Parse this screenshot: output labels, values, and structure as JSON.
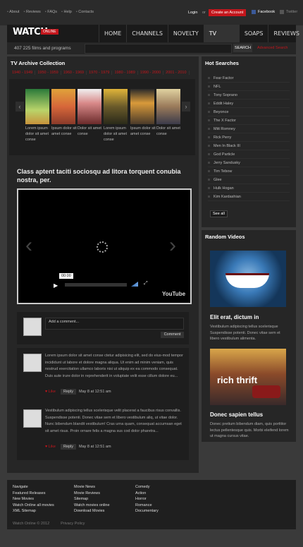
{
  "topbar": {
    "links": [
      "About",
      "Reviews",
      "FAQs",
      "Help",
      "Contacts"
    ],
    "login": "Login",
    "or": "or",
    "create_account": "Create an Account",
    "facebook": "Facebook",
    "twitter": "Twitter"
  },
  "logo": {
    "text": "WATCH",
    "badge": "ONLINE"
  },
  "nav": [
    "HOME",
    "CHANNELS",
    "NOVELTY",
    "TV ARCHIVE",
    "SOAPS",
    "REVIEWS"
  ],
  "search": {
    "count_text": "407 225 films and programs",
    "button": "SEARCH",
    "advanced": "Advanced Search"
  },
  "archive": {
    "title": "TV Archive Collection",
    "years": [
      "1940 - 1949",
      "1950 - 1959",
      "1960 - 1969",
      "1970 - 1979",
      "1980 - 1989",
      "1990 - 2000",
      "2001 - 2010"
    ],
    "items": [
      {
        "caption": "Lorem ipsum dolor sit amet conse"
      },
      {
        "caption": "Ipsum dolor sit amet conse"
      },
      {
        "caption": "Dolor sit amet conse"
      },
      {
        "caption": "Lorem ipsum dolor sit amet conse"
      },
      {
        "caption": "Ipsum dolor sit amet conse"
      },
      {
        "caption": "Dolor sit amet conse"
      }
    ]
  },
  "article": {
    "title": "Class aptent taciti sociosqu ad litora torquent conubia nostra, per."
  },
  "player": {
    "time": "00:00",
    "brand": "YouTube"
  },
  "comment_form": {
    "placeholder": "Add a comment...",
    "button": "Comment"
  },
  "comments": [
    {
      "text": "Lorem ipsum dolor sit amet conse ctetur adipisicing elit, sed do eius-mod tempor incididunt ut labore et dolore magna aliqua. Ut enim ad minim veniam, quis nostrud exercitation ullamco laboris nisi ut aliquip ex ea commodo consequat. Duis aute irure dolor in reprehenderit in voluptate velit esse cillum dolore eu...",
      "like": "Like",
      "reply": "Reply",
      "date": "May 8 at 12:51 am"
    },
    {
      "text": "Vestibulum adipiscing tellus scelerisque velit placerat a faucibus risus convallis. Suspendisse potenti. Donec vitae sem et libero vestibulum aliq, ut vitae dolor. Nunc bibendum blandit vestibulum! Cras urna quam, consequat accumsan eget sit amet risus. Proin ornare felis a magna sus cod dolor pharetra...",
      "like": "Like",
      "reply": "Reply",
      "date": "May 8 at 12:51 am"
    }
  ],
  "hot_searches": {
    "title": "Hot Searches",
    "items": [
      "Fear Factor",
      "NFL",
      "Tony Soprano",
      "Eddit Haley",
      "Beyonce",
      "The X Factor",
      "Mitt Romney",
      "Rick Perry",
      "Men In Black III",
      "God Particle",
      "Jerry Sandusky",
      "Tim Tebow",
      "Glee",
      "Hulk Hogan",
      "Kim Kardashian"
    ],
    "see_all": "See all"
  },
  "random_videos": {
    "title": "Random Videos",
    "videos": [
      {
        "title": "Elit erat, dictum in",
        "text": "Vestibulum adipiscing tellus scelerisque Suspendisse potenti. Donec vitae sem et libero vestibulum alimenta.",
        "overlay": ""
      },
      {
        "title": "Donec sapien tellus",
        "text": "Donec pretium bibendum diam, quis porttitor lectus pellentesque quis. Morbi eleifend lorem ut magna cursus vitae.",
        "overlay": "rich thrift"
      }
    ]
  },
  "footer": {
    "col1": [
      "Navigate",
      "Featured Releases",
      "New Movies",
      "Watch Online all movies",
      "XML Sitemap"
    ],
    "col2": [
      "Movie News",
      "Movie Reviews",
      "Sitemap",
      "Watch movies online",
      "Download Movies"
    ],
    "col3": [
      "Comedy",
      "Action",
      "Horror",
      "Romance",
      "Documentary"
    ],
    "copyright": "Watch Online © 2012",
    "privacy": "Privacy Policy"
  },
  "colors": {
    "accent": "#c4161c",
    "panel": "#262626",
    "page": "#3a3a3a"
  }
}
